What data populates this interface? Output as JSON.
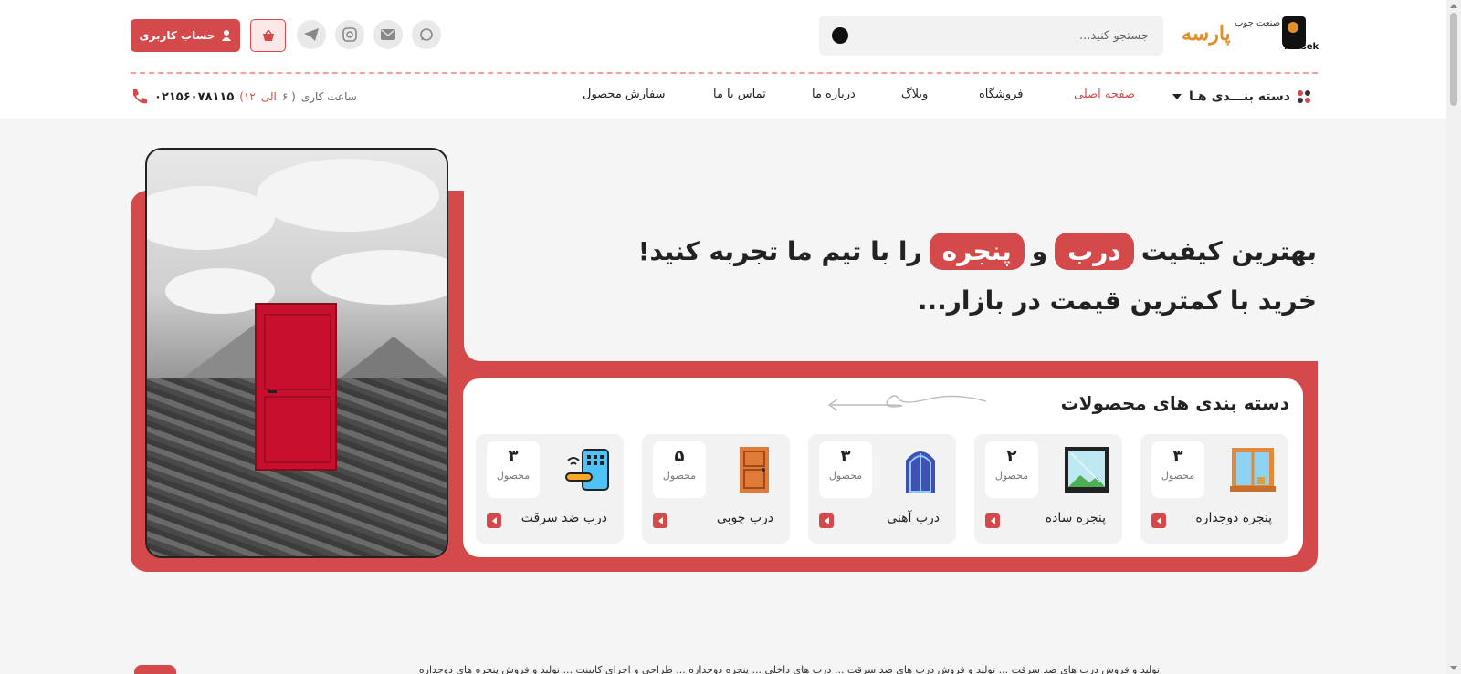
{
  "header": {
    "logo_text_fa": "پارسه",
    "logo_sub_text": "سایه صنعت چوب",
    "logo_text_en": "Parsek",
    "search_placeholder": "جستجو کنید...",
    "account_button": "حساب کاربری",
    "social_icons": [
      "whatsapp-icon",
      "mail-icon",
      "instagram-icon",
      "telegram-icon"
    ]
  },
  "nav": {
    "categories_label": "دسته بنـــدی هـا",
    "items": [
      "صفحه اصلی",
      "فروشگاه",
      "وبلاگ",
      "درباره ما",
      "تماس با ما",
      "سفارش محصول"
    ],
    "work_hours_label": "ساعت کاری",
    "work_hours_open": "( ۶",
    "work_hours_mid": "الی",
    "work_hours_close": "۱۲)",
    "phone": "۰۲۱۵۶۰۷۸۱۱۵"
  },
  "hero": {
    "line1_pre": "بهترین کیفیت",
    "word1": "درب",
    "and": "و",
    "word2": "پنجره",
    "line1_post": "را با تیم ما تجربه کنید!",
    "line2": "خرید با کمترین قیمت در بازار..."
  },
  "categories": {
    "title": "دسته بندی های محصولات",
    "unit": "محصول",
    "items": [
      {
        "name": "پنجره دوجداره",
        "count": "۳"
      },
      {
        "name": "پنجره ساده",
        "count": "۲"
      },
      {
        "name": "درب آهنی",
        "count": "۳"
      },
      {
        "name": "درب چوبی",
        "count": "۵"
      },
      {
        "name": "درب ضد سرقت",
        "count": "۳"
      }
    ]
  },
  "bottom_strip": "تولید و فروش درب های ضد سرقت ... تولید و فروش درب های ضد سرقت ... درب های داخلی ... پنجره دوجداره ... طراحی و اجرای کابینت ... تولید و فروش پنجره های دوجداره"
}
